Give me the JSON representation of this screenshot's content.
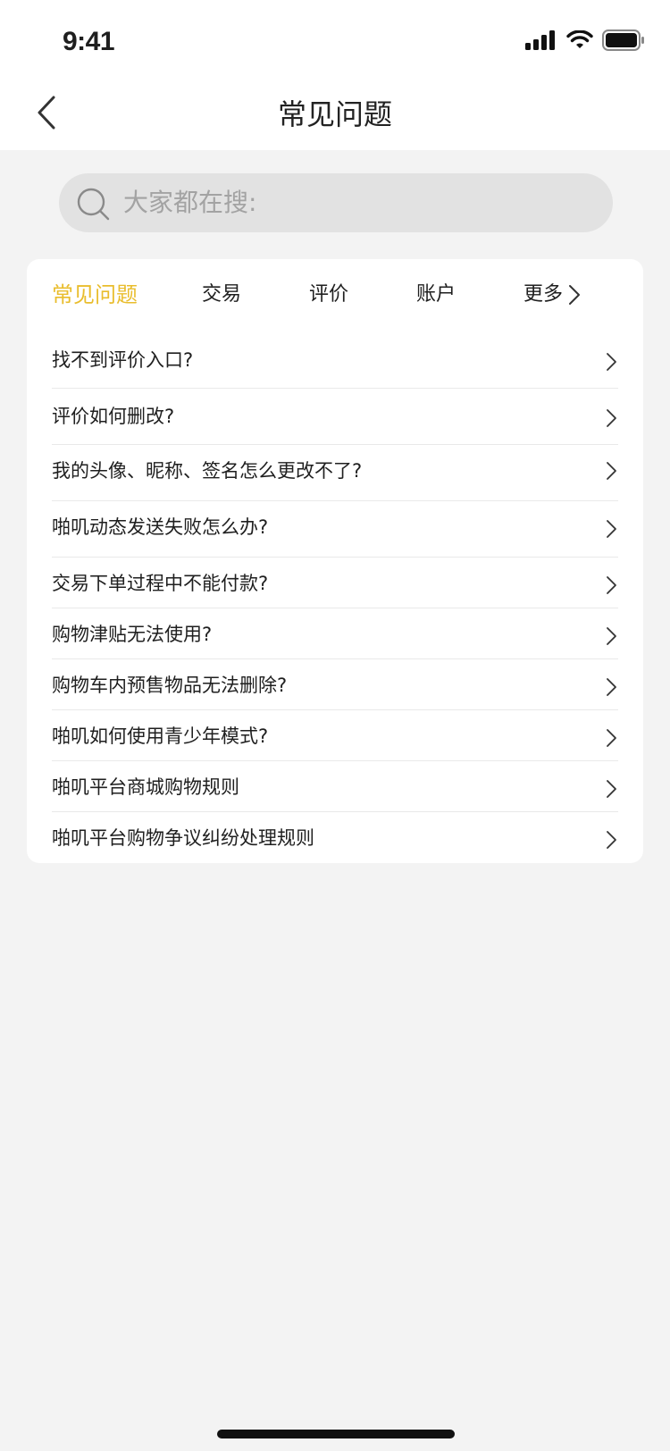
{
  "status_bar": {
    "time": "9:41"
  },
  "nav": {
    "title": "常见问题"
  },
  "search": {
    "placeholder": "大家都在搜:"
  },
  "tabs": [
    {
      "label": "常见问题",
      "active": true
    },
    {
      "label": "交易",
      "active": false
    },
    {
      "label": "评价",
      "active": false
    },
    {
      "label": "账户",
      "active": false
    },
    {
      "label": "更多",
      "active": false
    }
  ],
  "faq": [
    {
      "question": "找不到评价入口?"
    },
    {
      "question": "评价如何删改?"
    },
    {
      "question": "我的头像、昵称、签名怎么更改不了?"
    },
    {
      "question": "啪叽动态发送失败怎么办?"
    },
    {
      "question": "交易下单过程中不能付款?"
    },
    {
      "question": "购物津贴无法使用?"
    },
    {
      "question": "购物车内预售物品无法删除?"
    },
    {
      "question": "啪叽如何使用青少年模式?"
    },
    {
      "question": "啪叽平台商城购物规则"
    },
    {
      "question": "啪叽平台购物争议纠纷处理规则"
    }
  ],
  "colors": {
    "accent": "#e9bd2d",
    "background": "#f3f3f3",
    "card": "#ffffff",
    "search_bg": "#e2e2e2"
  }
}
